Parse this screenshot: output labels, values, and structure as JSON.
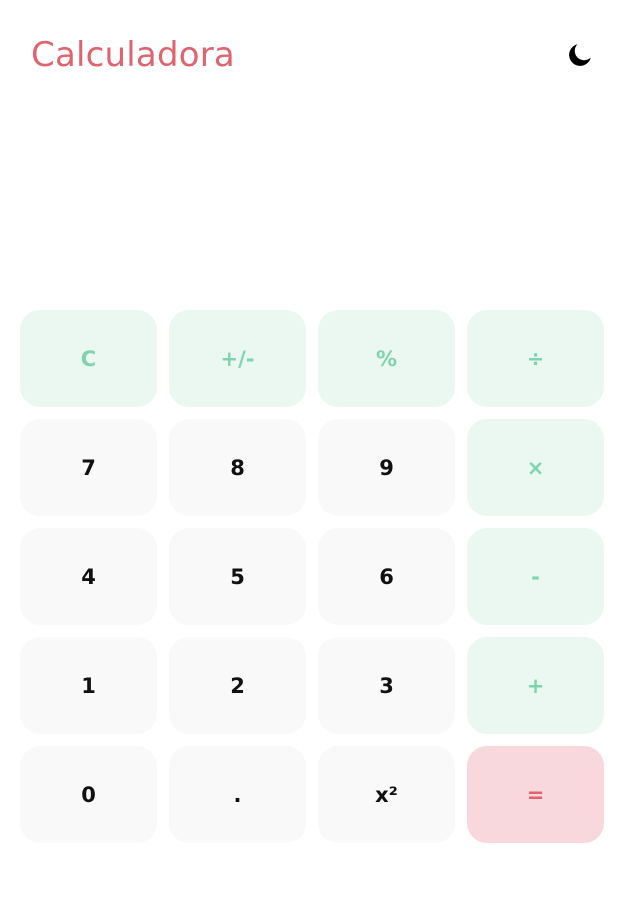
{
  "header": {
    "title": "Calculadora",
    "theme_icon": "moon-icon"
  },
  "display": {
    "value": ""
  },
  "colors": {
    "accent": "#e0646f",
    "operator_text": "#7fd4ae",
    "operator_bg": "#eaf8f1",
    "number_bg": "#f9f9f9",
    "equals_bg": "#f8d8dc"
  },
  "keys": {
    "clear": "C",
    "negate": "+/-",
    "percent": "%",
    "divide": "÷",
    "seven": "7",
    "eight": "8",
    "nine": "9",
    "multiply": "×",
    "four": "4",
    "five": "5",
    "six": "6",
    "subtract": "-",
    "one": "1",
    "two": "2",
    "three": "3",
    "add": "+",
    "zero": "0",
    "decimal": ".",
    "square": "x²",
    "equals": "="
  }
}
